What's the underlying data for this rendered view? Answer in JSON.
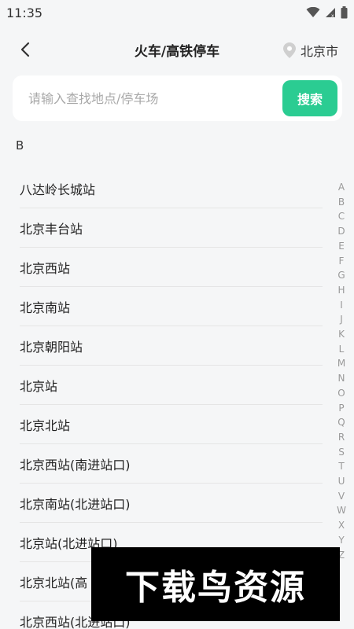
{
  "status_bar": {
    "time": "11:35"
  },
  "header": {
    "title": "火车/高铁停车",
    "city": "北京市"
  },
  "search": {
    "placeholder": "请输入查找地点/停车场",
    "button": "搜索"
  },
  "section": {
    "letter": "B"
  },
  "stations": [
    "八达岭长城站",
    "北京丰台站",
    "北京西站",
    "北京南站",
    "北京朝阳站",
    "北京站",
    "北京北站",
    "北京西站(南进站口)",
    "北京南站(北进站口)",
    "北京站(北进站口)",
    "北京北站(高",
    "北京西站(北进站口)"
  ],
  "alphabet": [
    "A",
    "B",
    "C",
    "D",
    "E",
    "F",
    "G",
    "H",
    "I",
    "J",
    "K",
    "L",
    "M",
    "N",
    "O",
    "P",
    "Q",
    "R",
    "S",
    "T",
    "U",
    "V",
    "W",
    "X",
    "Y",
    "Z"
  ],
  "watermark": {
    "text": "下载鸟资源"
  },
  "colors": {
    "accent": "#2bcc92",
    "background": "#f5f6f7"
  }
}
